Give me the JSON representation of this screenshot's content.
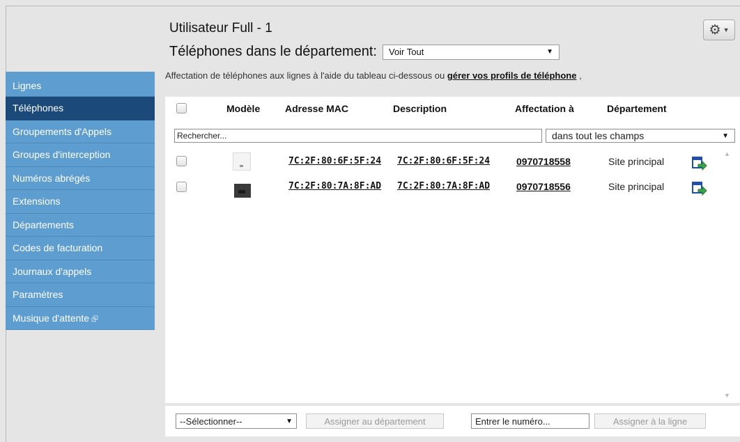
{
  "header": {
    "title": "Utilisateur Full - 1",
    "department_label": "Téléphones dans le département:",
    "department_value": "Voir Tout",
    "info_text": "Affectation de téléphones aux lignes à l'aide du tableau ci-dessous ou ",
    "info_link": "gérer vos profils de téléphone",
    "info_suffix": " ,"
  },
  "sidebar": {
    "items": [
      {
        "label": "Lignes",
        "active": false
      },
      {
        "label": "Téléphones",
        "active": true
      },
      {
        "label": "Groupements d'Appels",
        "active": false
      },
      {
        "label": "Groupes d'interception",
        "active": false
      },
      {
        "label": "Numéros abrégés",
        "active": false
      },
      {
        "label": "Extensions",
        "active": false
      },
      {
        "label": "Départements",
        "active": false
      },
      {
        "label": "Codes de facturation",
        "active": false
      },
      {
        "label": "Journaux d'appels",
        "active": false
      },
      {
        "label": "Paramètres",
        "active": false
      },
      {
        "label": "Musique d'attente",
        "active": false,
        "external": true
      }
    ]
  },
  "table": {
    "columns": {
      "model": "Modèle",
      "mac": "Adresse MAC",
      "description": "Description",
      "assignment": "Affectation à",
      "department": "Département"
    },
    "search_placeholder": "Rechercher...",
    "search_scope": "dans tout les champs",
    "rows": [
      {
        "model_icon": "white-desk-phone",
        "mac": "7C:2F:80:6F:5F:24",
        "description": "7C:2F:80:6F:5F:24",
        "assignment": "0970718558",
        "department": "Site principal"
      },
      {
        "model_icon": "black-desk-phone",
        "mac": "7C:2F:80:7A:8F:AD",
        "description": "7C:2F:80:7A:8F:AD",
        "assignment": "0970718556",
        "department": "Site principal"
      }
    ]
  },
  "footer": {
    "bulk_select": "--Sélectionner--",
    "assign_department_button": "Assigner au département",
    "number_input": "Entrer le numéro...",
    "assign_line_button": "Assigner à la ligne"
  },
  "icons": {
    "settings": "gear-icon",
    "assign": "assign-arrow-icon"
  },
  "colors": {
    "sidebar": "#5e9dcf",
    "sidebar_active": "#1b4a7a",
    "assign_icon_blue": "#1f4fa8",
    "assign_icon_green": "#3aa64a"
  }
}
